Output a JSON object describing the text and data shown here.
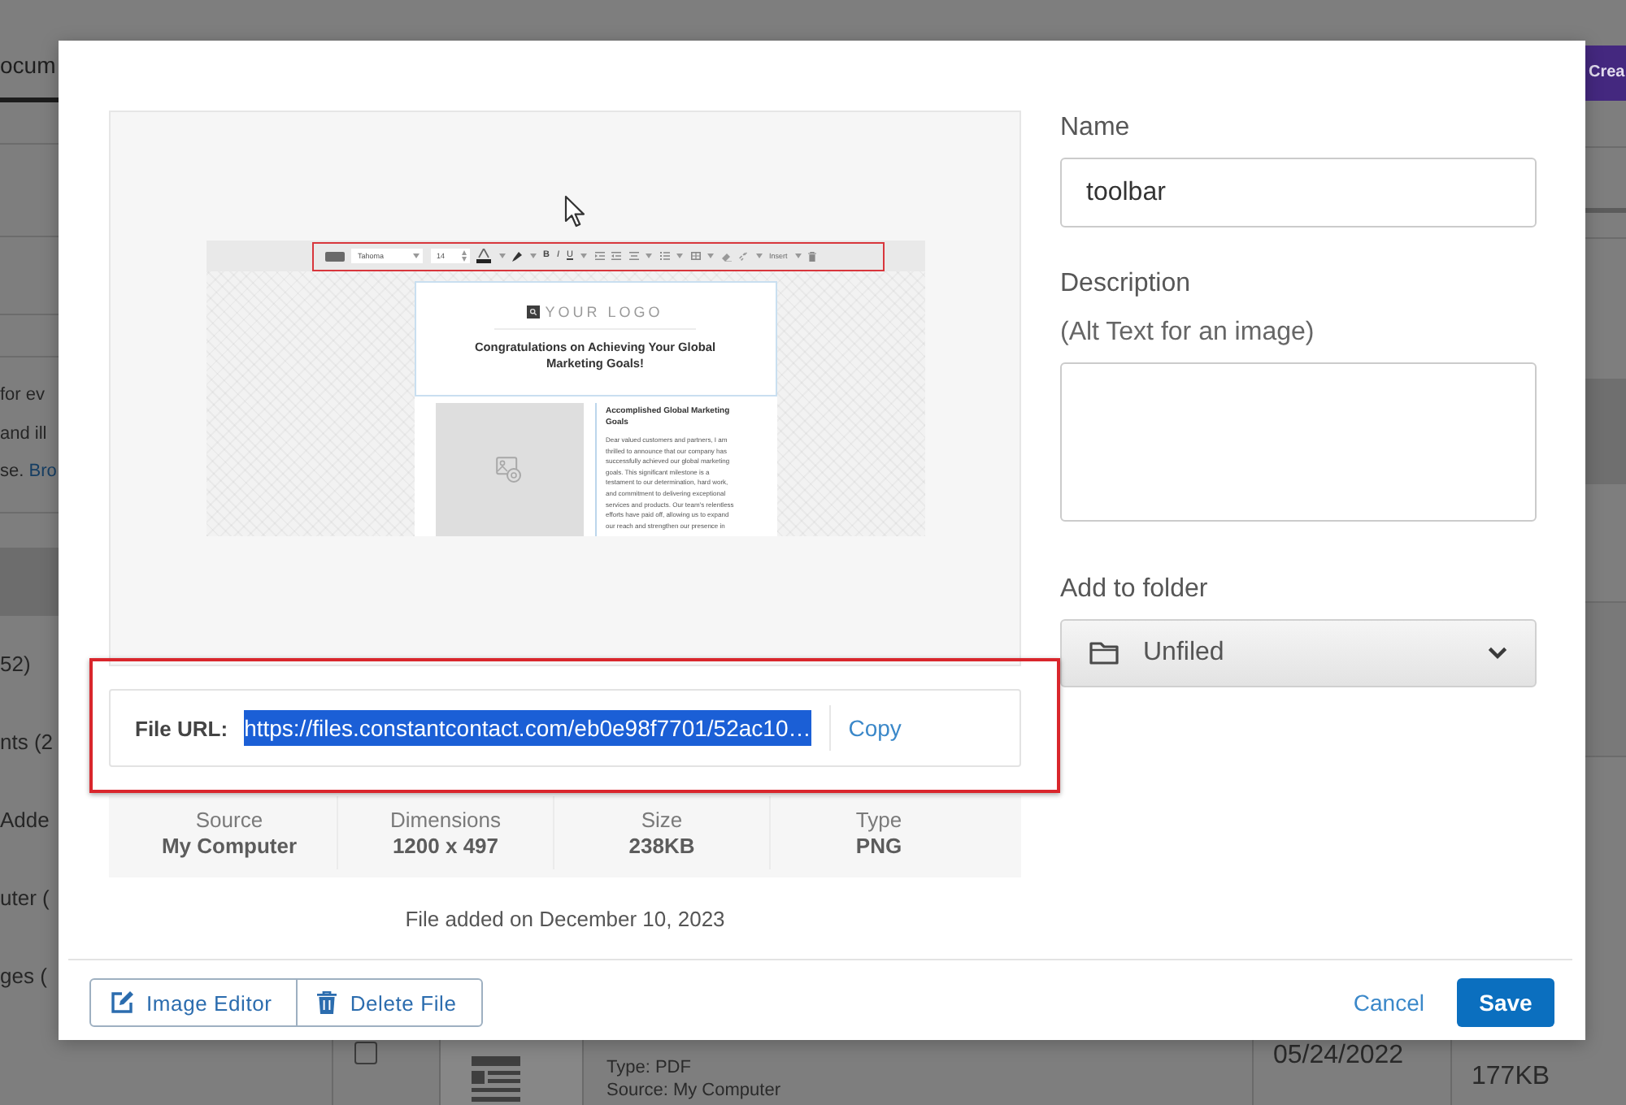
{
  "page": {
    "tab": {
      "label": "ocum",
      "selected": true
    },
    "header_button": "Crea",
    "intro": [
      {
        "text": "for ev"
      },
      {
        "text": "and ill"
      },
      {
        "text": "se.",
        "link": "Bro"
      }
    ],
    "sidebar_items": [
      {
        "selected": true
      },
      {
        "label": "52)",
        "selected": false
      },
      {
        "label": "nts (2",
        "selected": false
      },
      {
        "label": "Adde",
        "selected": false
      },
      {
        "label": "uter (",
        "selected": false
      },
      {
        "label": "ges (",
        "selected": false
      }
    ],
    "file_row": {
      "checked": false,
      "type": "Type: PDF",
      "source": "Source: My Computer",
      "date": "05/24/2022",
      "size": "177KB"
    }
  },
  "dialog": {
    "preview": {
      "screenshot": {
        "toolbar": {
          "font": "Tahoma",
          "size": "14",
          "bold": "B",
          "italic": "I",
          "underline": "U",
          "insert": "Insert"
        },
        "logo": "YOUR LOGO",
        "headline": "Congratulations on Achieving Your Global Marketing Goals!",
        "article_title": "Accomplished Global Marketing Goals",
        "article_body": "Dear valued customers and partners, I am thrilled to announce that our company has successfully achieved our global marketing goals. This significant milestone is a testament to our determination, hard work, and commitment to delivering exceptional services and products. Our team's relentless efforts have paid off, allowing us to expand our reach and strengthen our presence in"
      },
      "file_url": {
        "label": "File URL:",
        "value": "https://files.constantcontact.com/eb0e98f7701/52ac10…",
        "selected": true,
        "action": "Copy"
      },
      "details": [
        {
          "label": "Source",
          "value": "My Computer"
        },
        {
          "label": "Dimensions",
          "value": "1200 x 497"
        },
        {
          "label": "Size",
          "value": "238KB"
        },
        {
          "label": "Type",
          "value": "PNG"
        }
      ],
      "added": "File added on December 10, 2023"
    },
    "form": {
      "name": {
        "label": "Name",
        "value": "toolbar"
      },
      "description": {
        "label": "Description",
        "sublabel": "(Alt Text for an image)"
      },
      "folder": {
        "label": "Add to folder",
        "value": "Unfiled"
      }
    },
    "footer": {
      "tools": [
        {
          "kind": "edit",
          "label": "Image Editor"
        },
        {
          "kind": "delete",
          "label": "Delete File"
        }
      ],
      "cancel": "Cancel",
      "save": "Save"
    }
  }
}
